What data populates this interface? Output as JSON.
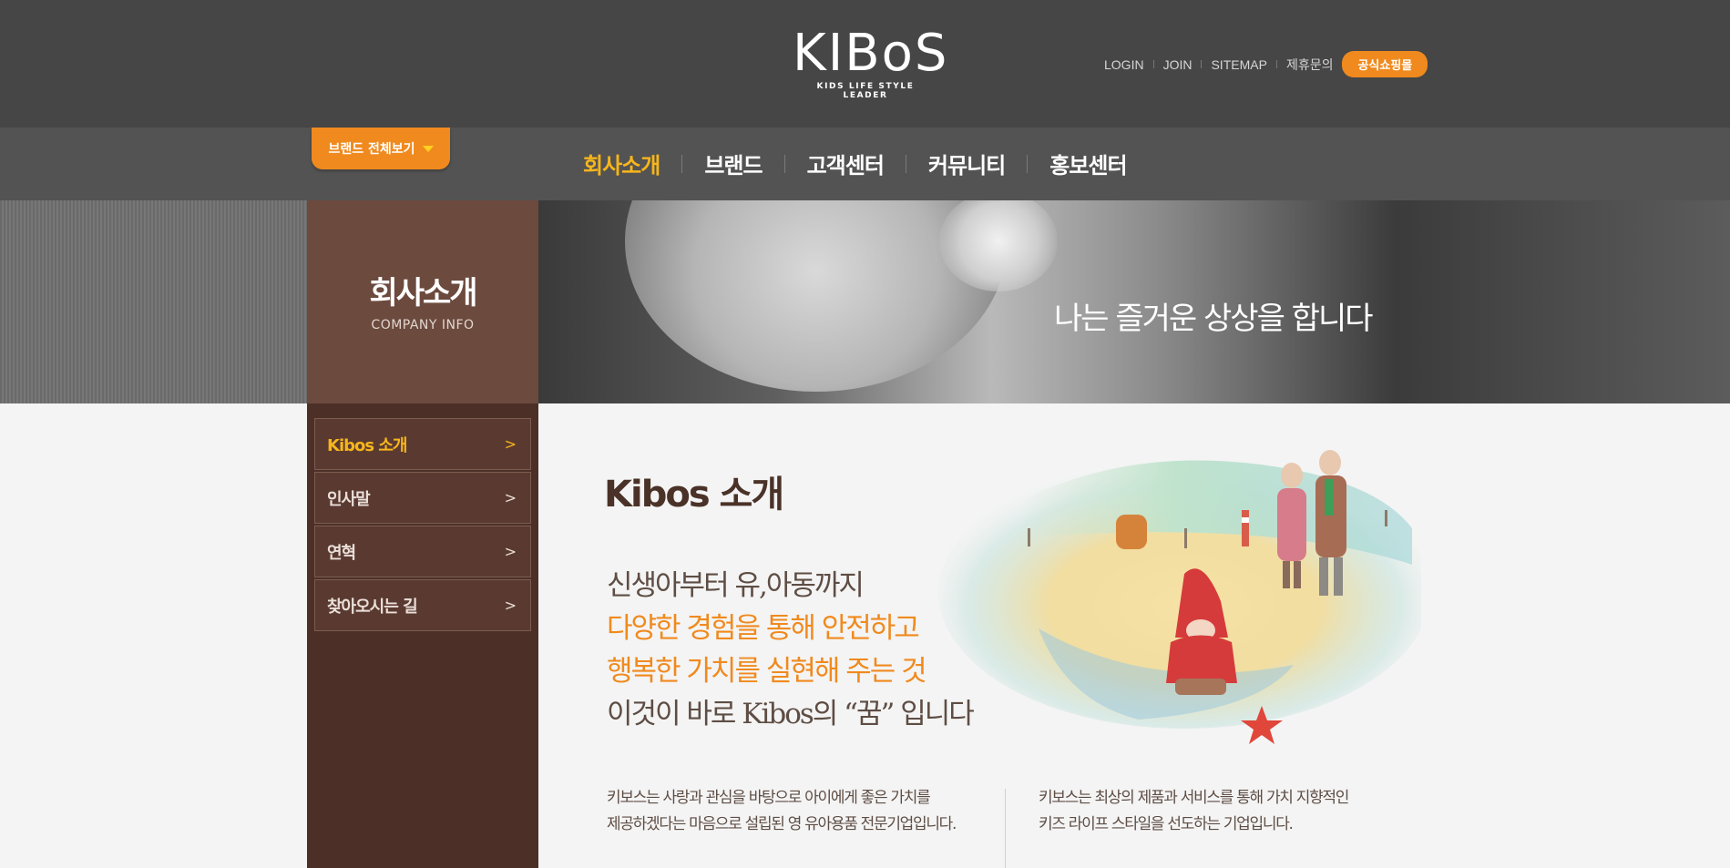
{
  "header": {
    "logo_text": "KIBoS",
    "logo_tagline": "KIDS LIFE STYLE LEADER",
    "util_links": [
      "LOGIN",
      "JOIN",
      "SITEMAP",
      "제휴문의"
    ],
    "shop_button": "공식쇼핑몰"
  },
  "nav": {
    "brand_all": "브랜드 전체보기",
    "items": [
      "회사소개",
      "브랜드",
      "고객센터",
      "커뮤니티",
      "홍보센터"
    ],
    "active_index": 0
  },
  "banner": {
    "title_ko": "회사소개",
    "title_en": "COMPANY INFO",
    "slogan": "나는 즐거운 상상을 합니다"
  },
  "sidebar": {
    "items": [
      {
        "label": "Kibos 소개",
        "active": true
      },
      {
        "label": "인사말",
        "active": false
      },
      {
        "label": "연혁",
        "active": false
      },
      {
        "label": "찾아오시는 길",
        "active": false
      }
    ]
  },
  "content": {
    "title": "Kibos 소개",
    "lead": [
      "신생아부터 유,아동까지",
      "다양한 경험을 통해 안전하고",
      "행복한 가치를 실현해 주는 것",
      "이것이 바로 Kibos의 “꿈” 입니다"
    ],
    "desc_left": [
      "키보스는 사랑과 관심을 바탕으로 아이에게 좋은 가치를",
      "제공하겠다는 마음으로 설립된 영 유아용품 전문기업입니다."
    ],
    "desc_right": [
      "키보스는 최상의 제품과 서비스를 통해 가치 지향적인",
      "키즈 라이프 스타일을 선도하는 기업입니다."
    ]
  },
  "colors": {
    "header_bg": "#464646",
    "nav_bg": "#535353",
    "accent_orange": "#f08a1e",
    "active_yellow": "#f7b61c",
    "sidebar_brown": "#4c3028",
    "title_box_brown": "#6c4a3e"
  }
}
